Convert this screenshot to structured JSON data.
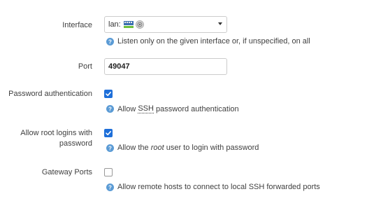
{
  "interface": {
    "label": "Interface",
    "select_prefix": "lan:",
    "icons": [
      "network-port-icon",
      "wireless-icon"
    ],
    "hint": "Listen only on the given interface or, if unspecified, on all"
  },
  "port": {
    "label": "Port",
    "value": "49047"
  },
  "password_auth": {
    "label": "Password authentication",
    "checked": true,
    "hint_pre": "Allow ",
    "hint_abbr": "SSH",
    "hint_post": " password authentication"
  },
  "root_login": {
    "label_line1": "Allow root logins with",
    "label_line2": "password",
    "checked": true,
    "hint_pre": "Allow the ",
    "hint_em": "root",
    "hint_post": " user to login with password"
  },
  "gateway_ports": {
    "label": "Gateway Ports",
    "checked": false,
    "hint": "Allow remote hosts to connect to local SSH forwarded ports"
  },
  "colors": {
    "checkbox_checked": "#1e6fd9",
    "help_icon": "#5b9bd5"
  }
}
